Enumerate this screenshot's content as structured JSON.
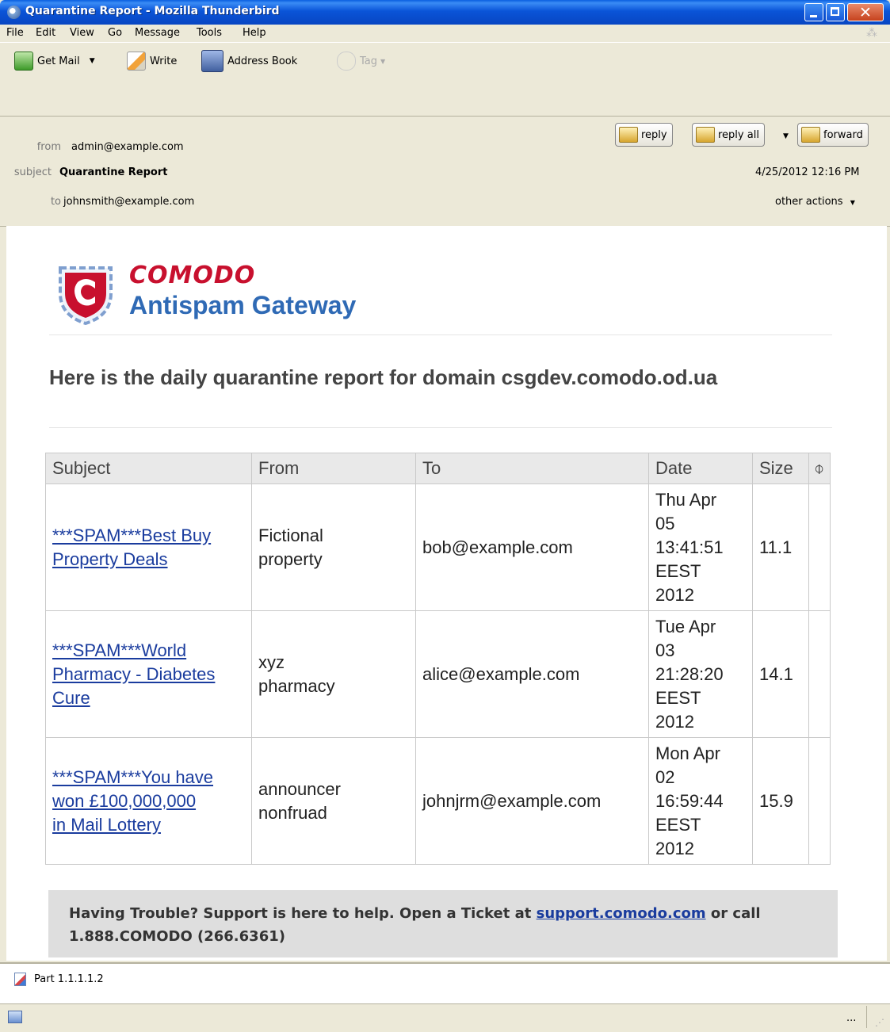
{
  "window": {
    "title": "Quarantine Report - Mozilla Thunderbird"
  },
  "menu": [
    "File",
    "Edit",
    "View",
    "Go",
    "Message",
    "Tools",
    "Help"
  ],
  "toolbar": {
    "get_mail": "Get Mail",
    "write": "Write",
    "address_book": "Address Book",
    "tag": "Tag"
  },
  "header": {
    "from_label": "from",
    "from_value": "admin@example.com",
    "subject_label": "subject",
    "subject_value": "Quarantine Report",
    "to_label": "to",
    "to_value": "johnsmith@example.com",
    "date": "4/25/2012 12:16 PM",
    "reply": "reply",
    "reply_all": "reply all",
    "forward": "forward",
    "other_actions": "other actions"
  },
  "body": {
    "brand_name": "COMODO",
    "brand_product": "Antispam Gateway",
    "headline": "Here is the daily quarantine report for domain csgdev.comodo.od.ua",
    "table": {
      "headers": [
        "Subject",
        "From",
        "To",
        "Date",
        "Size"
      ],
      "rows": [
        {
          "subject_1": "***SPAM***Best Buy",
          "subject_2": "Property Deals",
          "subject_3": "",
          "from_1": "Fictional",
          "from_2": "property",
          "to": "bob@example.com",
          "date_1": "Thu Apr",
          "date_2": "05",
          "date_3": "13:41:51",
          "date_4": "EEST",
          "date_5": "2012",
          "size": "11.1"
        },
        {
          "subject_1": "***SPAM***World",
          "subject_2": "Pharmacy  - Diabetes",
          "subject_3": " Cure",
          "from_1": "xyz",
          "from_2": "pharmacy",
          "to": "alice@example.com",
          "date_1": "Tue Apr",
          "date_2": "03",
          "date_3": "21:28:20",
          "date_4": "EEST",
          "date_5": "2012",
          "size": "14.1"
        },
        {
          "subject_1": "***SPAM***You have",
          "subject_2": "won £100,000,000",
          "subject_3": "in Mail Lottery",
          "from_1": "announcer",
          "from_2": "nonfruad",
          "to": "johnjrm@example.com",
          "date_1": "Mon Apr",
          "date_2": "02",
          "date_3": "16:59:44",
          "date_4": "EEST",
          "date_5": "2012",
          "size": "15.9"
        }
      ]
    },
    "support": {
      "text_1": "Having Trouble? Support is here to help. Open a Ticket at ",
      "link": "support.comodo.com",
      "text_2": " or call",
      "text_3": "1.888.COMODO (266.6361)"
    }
  },
  "attachment": {
    "name": "Part 1.1.1.1.2"
  },
  "status": {
    "text": "..."
  }
}
